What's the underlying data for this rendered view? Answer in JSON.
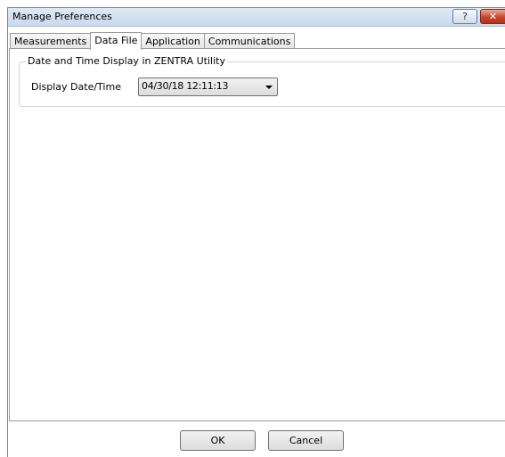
{
  "window": {
    "title": "Manage Preferences",
    "help_label": "?",
    "close_label": "✕"
  },
  "tabs": [
    {
      "label": "Measurements",
      "active": false
    },
    {
      "label": "Data File",
      "active": true
    },
    {
      "label": "Application",
      "active": false
    },
    {
      "label": "Communications",
      "active": false
    }
  ],
  "datetime_group": {
    "legend": "Date and Time Display in ZENTRA Utility",
    "field_label": "Display Date/Time",
    "selected_value": "04/30/18 12:11:13"
  },
  "footer": {
    "ok_label": "OK",
    "cancel_label": "Cancel"
  }
}
